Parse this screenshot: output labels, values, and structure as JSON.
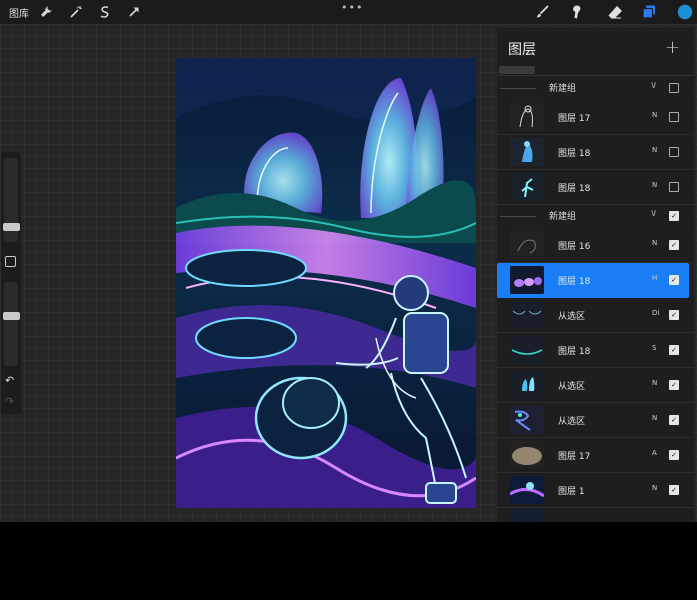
{
  "topbar": {
    "gallery_label": "图库",
    "left_tools": [
      "wrench-icon",
      "magic-wand-icon",
      "selection-icon",
      "transform-arrow-icon"
    ],
    "more_label": "•••",
    "right_tools": [
      "brush-icon",
      "smudge-icon",
      "eraser-icon",
      "layers-icon",
      "color-swatch"
    ],
    "active_color": "#1e8fd6",
    "layers_active_color": "#2a7df5"
  },
  "sidebar": {
    "undo_label": "↶",
    "redo_label": "↷"
  },
  "layers_panel": {
    "title": "图层",
    "add_label": "+",
    "groups": [
      {
        "name": "新建组",
        "expanded": true,
        "checked": false,
        "layers": [
          {
            "name": "图层 17",
            "blend": "N",
            "checked": false,
            "selected": false
          },
          {
            "name": "图层 18",
            "blend": "N",
            "checked": false,
            "selected": false
          },
          {
            "name": "图层 18",
            "blend": "N",
            "checked": false,
            "selected": false
          }
        ]
      },
      {
        "name": "新建组",
        "expanded": true,
        "checked": true,
        "layers": [
          {
            "name": "图层 16",
            "blend": "N",
            "checked": true,
            "selected": false
          },
          {
            "name": "图层 18",
            "blend": "H",
            "checked": true,
            "selected": true
          },
          {
            "name": "从选区",
            "blend": "Di",
            "checked": true,
            "selected": false
          },
          {
            "name": "图层 18",
            "blend": "S",
            "checked": true,
            "selected": false
          },
          {
            "name": "从选区",
            "blend": "N",
            "checked": true,
            "selected": false
          },
          {
            "name": "从选区",
            "blend": "N",
            "checked": true,
            "selected": false
          },
          {
            "name": "图层 17",
            "blend": "A",
            "checked": true,
            "selected": false
          },
          {
            "name": "图层 1",
            "blend": "N",
            "checked": true,
            "selected": false
          }
        ]
      }
    ]
  },
  "colors": {
    "selection": "#1a7ef7",
    "panel_bg": "#1e1e1e",
    "canvas_bg": "#262626"
  }
}
